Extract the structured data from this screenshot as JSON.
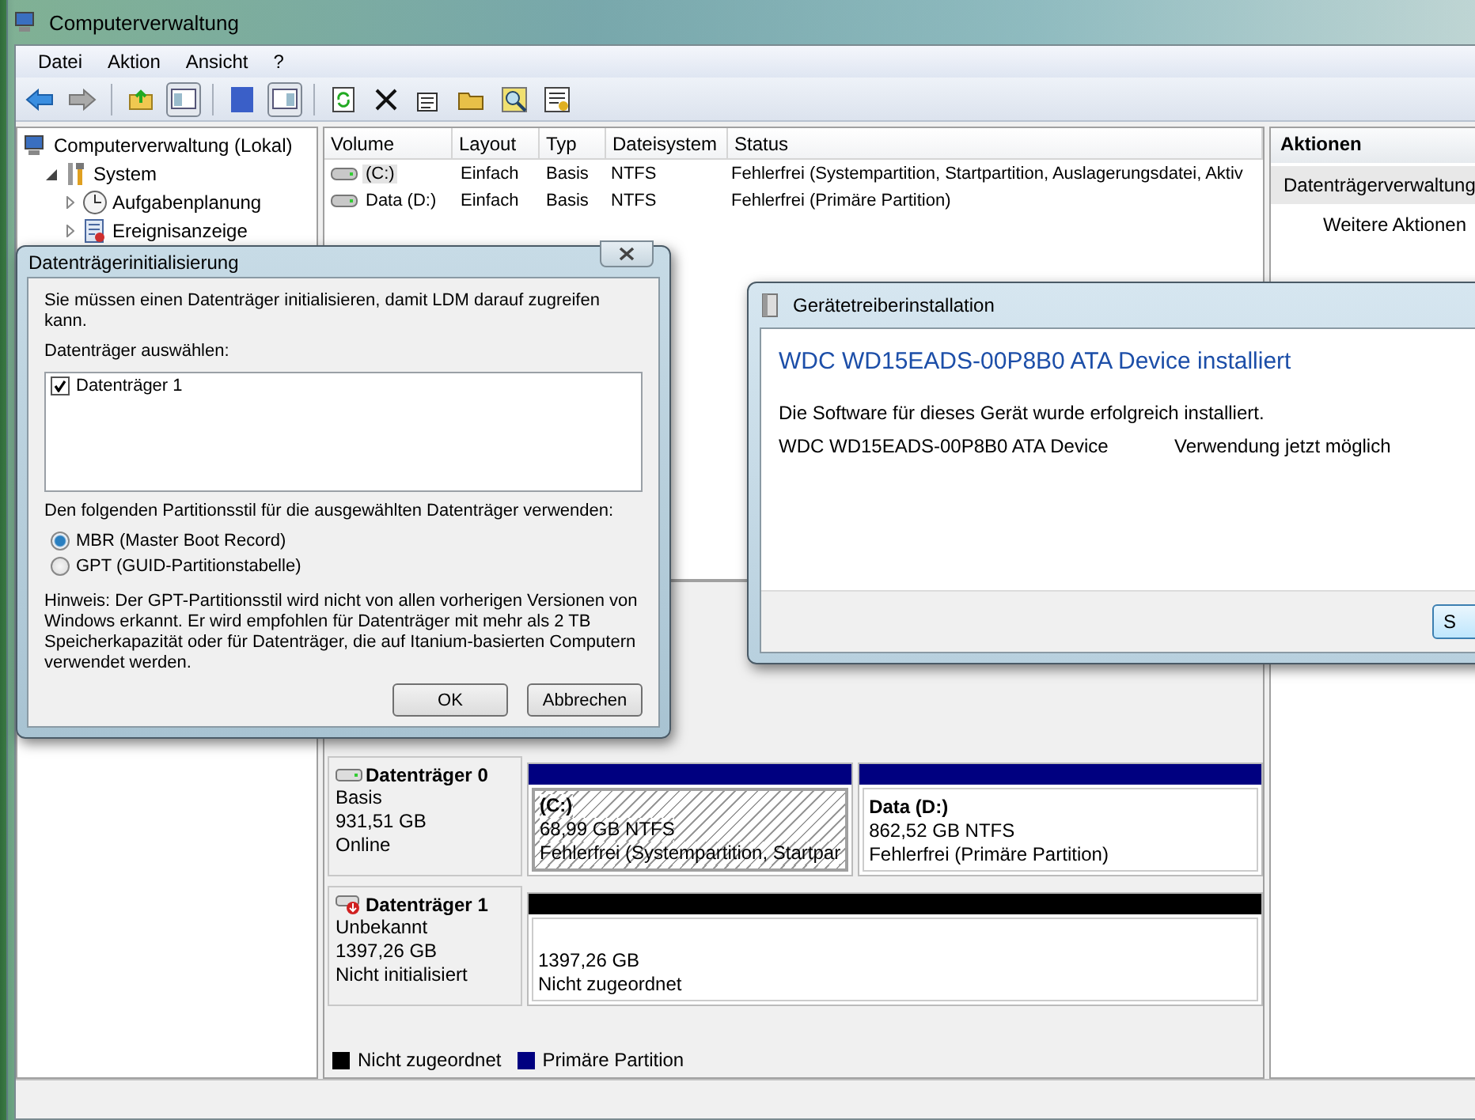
{
  "window": {
    "title": "Computerverwaltung"
  },
  "menu": [
    "Datei",
    "Aktion",
    "Ansicht",
    "?"
  ],
  "tree": [
    {
      "label": "Computerverwaltung (Lokal)",
      "kind": "computer",
      "children": [
        {
          "label": "System",
          "kind": "tools",
          "expanded": true,
          "children": [
            {
              "label": "Aufgabenplanung",
              "kind": "clock",
              "expanded": false
            },
            {
              "label": "Ereignisanzeige",
              "kind": "log",
              "expanded": false
            }
          ]
        }
      ]
    }
  ],
  "volumes": {
    "columns": [
      "Volume",
      "Layout",
      "Typ",
      "Dateisystem",
      "Status"
    ],
    "rows": [
      {
        "cells": [
          "(C:)",
          "Einfach",
          "Basis",
          "NTFS",
          "Fehlerfrei (Systempartition, Startpartition, Auslagerungsdatei, Aktiv"
        ],
        "selected": true
      },
      {
        "cells": [
          "Data (D:)",
          "Einfach",
          "Basis",
          "NTFS",
          "Fehlerfrei (Primäre Partition)"
        ],
        "selected": false
      }
    ]
  },
  "actions": {
    "title": "Aktionen",
    "items": [
      {
        "label": "Datenträgerverwaltung",
        "kind": "section"
      },
      {
        "label": "Weitere Aktionen",
        "kind": "action"
      }
    ]
  },
  "disks": [
    {
      "name": "Datenträger 0",
      "kind": "online",
      "lines": [
        "Basis",
        "931,51 GB",
        "Online"
      ],
      "partitions": [
        {
          "label": "(C:)",
          "size": "68,99 GB NTFS",
          "status": "Fehlerfrei (Systempartition, Startpar",
          "kind": "primary",
          "selected": true
        },
        {
          "label": "Data  (D:)",
          "size": "862,52 GB NTFS",
          "status": "Fehlerfrei (Primäre Partition)",
          "kind": "primary",
          "selected": false
        }
      ]
    },
    {
      "name": "Datenträger 1",
      "kind": "uninitialized",
      "lines": [
        "Unbekannt",
        "1397,26 GB",
        "Nicht initialisiert"
      ],
      "partitions": [
        {
          "size": "1397,26 GB",
          "status": "Nicht zugeordnet",
          "kind": "unallocated",
          "selected": false
        }
      ]
    }
  ],
  "legend": [
    {
      "label": "Nicht zugeordnet",
      "color": "#000000"
    },
    {
      "label": "Primäre Partition",
      "color": "#000080"
    }
  ],
  "init_dialog": {
    "title": "Datenträgerinitialisierung",
    "intro": "Sie müssen einen Datenträger initialisieren, damit LDM darauf zugreifen kann.",
    "select_label": "Datenträger auswählen:",
    "disks": [
      {
        "label": "Datenträger 1",
        "checked": true
      }
    ],
    "style_label": "Den folgenden Partitionsstil für die ausgewählten Datenträger verwenden:",
    "styles": [
      {
        "label": "MBR (Master Boot Record)",
        "selected": true
      },
      {
        "label": "GPT (GUID-Partitionstabelle)",
        "selected": false
      }
    ],
    "note": "Hinweis: Der GPT-Partitionsstil wird nicht von allen vorherigen Versionen von Windows erkannt. Er wird empfohlen für Datenträger mit mehr als 2 TB Speicherkapazität oder für Datenträger, die auf Itanium-basierten Computern verwendet werden.",
    "buttons": [
      "OK",
      "Abbrechen"
    ]
  },
  "driver_dialog": {
    "title": "Gerätetreiberinstallation",
    "heading": "WDC WD15EADS-00P8B0 ATA Device installiert",
    "message": "Die Software für dieses Gerät wurde erfolgreich installiert.",
    "devices": [
      {
        "name": "WDC WD15EADS-00P8B0 ATA Device",
        "status": "Verwendung jetzt möglich"
      }
    ],
    "buttons": [
      "S"
    ]
  }
}
